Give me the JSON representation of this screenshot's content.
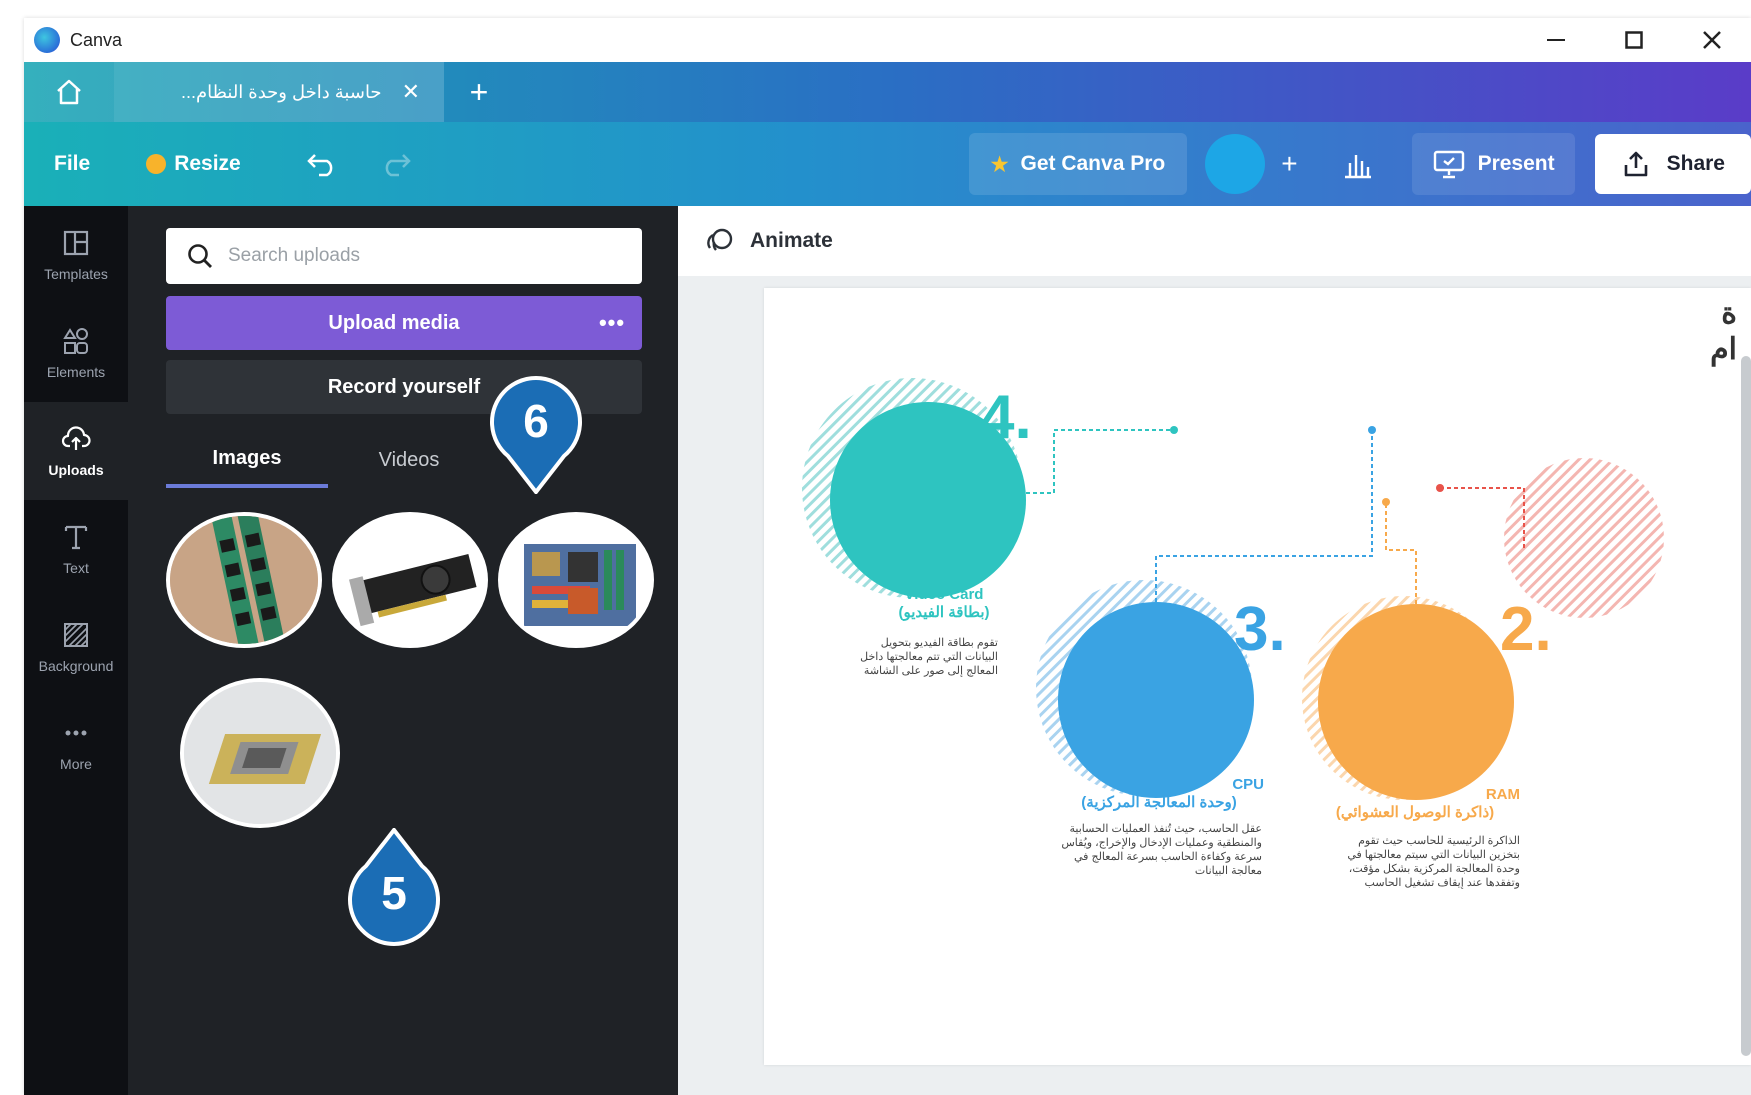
{
  "window": {
    "title": "Canva"
  },
  "tabs": {
    "doc_title": "حاسبة داخل وحدة النظام...",
    "close": "✕",
    "new": "+"
  },
  "toolbar": {
    "file": "File",
    "resize": "Resize",
    "pro": "Get Canva Pro",
    "plus": "+",
    "present": "Present",
    "share": "Share"
  },
  "rail": {
    "items": [
      {
        "label": "Templates",
        "icon": "templates-icon"
      },
      {
        "label": "Elements",
        "icon": "elements-icon"
      },
      {
        "label": "Uploads",
        "icon": "uploads-icon"
      },
      {
        "label": "Text",
        "icon": "text-icon"
      },
      {
        "label": "Background",
        "icon": "background-icon"
      },
      {
        "label": "More",
        "icon": "more-icon"
      }
    ]
  },
  "panel": {
    "search_placeholder": "Search uploads",
    "upload_media": "Upload media",
    "upload_more": "•••",
    "record": "Record yourself",
    "tab_images": "Images",
    "tab_videos": "Videos",
    "thumbnails": [
      "ram-sticks",
      "graphics-card",
      "motherboard",
      "cpu-chip"
    ]
  },
  "callouts": {
    "six": "6",
    "five": "5"
  },
  "canvas": {
    "animate": "Animate",
    "partial_title": "ة\nام",
    "items": [
      {
        "num": "4.",
        "en": "Video Card",
        "ar": "(بطاقة الفيديو)",
        "desc": "تقوم بطاقة الفيديو بتحويل البيانات التي تتم معالجتها داخل المعالج إلى صور على الشاشة",
        "color": "#2ec4c0"
      },
      {
        "num": "3.",
        "en": "CPU",
        "ar": "(وحدة المعالجة المركزية)",
        "desc": "عقل الحاسب، حيث تُنفذ العمليات الحسابية والمنطقية وعمليات الإدخال والإخراج، ويُقاس سرعة وكفاءة الحاسب بسرعة المعالج في معالجة البيانات",
        "color": "#3aa3e3"
      },
      {
        "num": "2.",
        "en": "RAM",
        "ar": "(ذاكرة الوصول العشوائي)",
        "desc": "الذاكرة الرئيسية للحاسب حيث تقوم بتخزين البيانات التي سيتم معالجتها في وحدة المعالجة المركزية بشكل مؤقت، وتفقدها عند إيقاف تشغيل الحاسب",
        "color": "#f7a94b"
      }
    ],
    "accent_red": "#e8534a"
  }
}
